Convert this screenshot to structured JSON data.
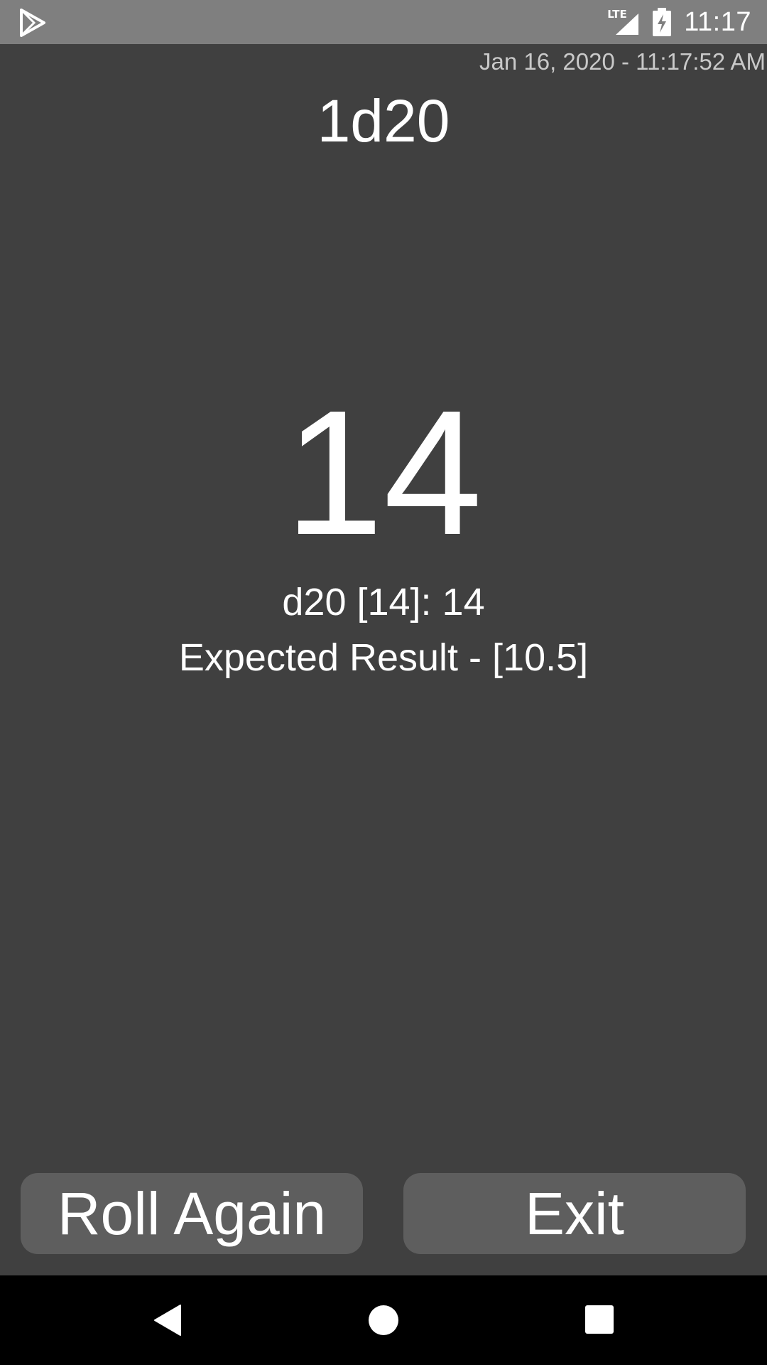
{
  "status_bar": {
    "time": "11:17",
    "network_label": "LTE",
    "icons": [
      "play-store-icon",
      "lte-signal-icon",
      "battery-charging-icon"
    ]
  },
  "screen": {
    "timestamp": "Jan 16, 2020 - 11:17:52 AM",
    "dice_notation": "1d20",
    "result": "14",
    "roll_detail": "d20 [14]: 14",
    "expected_result": "Expected Result - [10.5]"
  },
  "buttons": {
    "roll_again_label": "Roll Again",
    "exit_label": "Exit"
  },
  "nav_bar": {
    "icons": [
      "back-icon",
      "home-icon",
      "recents-icon"
    ]
  },
  "colors": {
    "background": "#404040",
    "status_bar": "#7f7f7f",
    "button": "#5e5e5e",
    "nav_bar": "#000000",
    "text": "#ffffff",
    "timestamp_text": "#c9c9c9"
  }
}
